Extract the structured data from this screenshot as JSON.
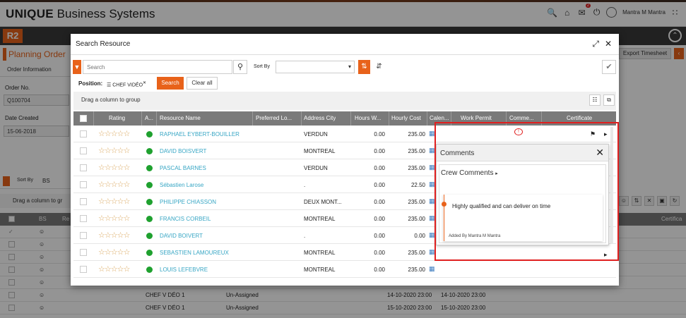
{
  "app": {
    "brand_bold": "UNIQUE",
    "brand_rest": " Business Systems",
    "user_name": "Mantra M Mantra",
    "notifications": "2",
    "module_badge": "R2"
  },
  "page": {
    "tab_title": "Planning Order",
    "sub_tab": "Order Information",
    "order_no_label": "Order No.",
    "order_no_value": "Q100704",
    "date_created_label": "Date Created",
    "date_created_value": "15-06-2018",
    "export_label": "Export Timesheet",
    "sort_by_label": "Sort By",
    "sort_by_value": "BS",
    "drag_text": "Drag a column to gr",
    "bg_headers": [
      "BS",
      "Re",
      "Certifica"
    ],
    "bg_rows": [
      {
        "position": "CHEF V DÉO 1",
        "status": "Un-Assigned",
        "start": "14-10-2020 23:00",
        "end": "14-10-2020 23:00"
      },
      {
        "position": "CHEF V DÉO 1",
        "status": "Un-Assigned",
        "start": "15-10-2020 23:00",
        "end": "15-10-2020 23:00"
      }
    ]
  },
  "modal": {
    "title": "Search Resource",
    "search_placeholder": "Search",
    "sort_by_label": "Sort By",
    "position_label": "Position:",
    "position_value": "CHEF VIDÉO",
    "search_button": "Search",
    "clear_button": "Clear all",
    "group_text": "Drag a column to group",
    "columns": [
      "Rating",
      "A...",
      "Resource Name",
      "Preferred Lo...",
      "Address City",
      "Hours W...",
      "Hourly Cost",
      "Calen...",
      "Work Permit",
      "Comme...",
      "Certificate"
    ],
    "rows": [
      {
        "rating": "☆☆☆☆☆",
        "name": "RAPHAEL EYBERT-BOUILLER",
        "city": "VERDUN",
        "hours": "0.00",
        "cost": "235.00"
      },
      {
        "rating": "☆☆☆☆☆",
        "name": "DAVID BOISVERT",
        "city": "MONTREAL",
        "hours": "0.00",
        "cost": "235.00"
      },
      {
        "rating": "☆☆☆☆☆",
        "name": "PASCAL BARNES",
        "city": "VERDUN",
        "hours": "0.00",
        "cost": "235.00"
      },
      {
        "rating": "☆☆☆☆☆",
        "name": "Sébastien Larose",
        "city": ".",
        "hours": "0.00",
        "cost": "22.50"
      },
      {
        "rating": "☆☆☆☆☆",
        "name": "PHILIPPE CHIASSON",
        "city": "DEUX MONT...",
        "hours": "0.00",
        "cost": "235.00"
      },
      {
        "rating": "☆☆☆☆☆",
        "name": "FRANCIS CORBEIL",
        "city": "MONTREAL",
        "hours": "0.00",
        "cost": "235.00"
      },
      {
        "rating": "☆☆☆☆☆",
        "name": "DAVID BOIVERT",
        "city": ".",
        "hours": "0.00",
        "cost": "0.00"
      },
      {
        "rating": "☆☆☆☆☆",
        "name": "SEBASTIEN LAMOUREUX",
        "city": "MONTREAL",
        "hours": "0.00",
        "cost": "235.00"
      },
      {
        "rating": "☆☆☆☆☆",
        "name": "LOUIS LEFEBVRE",
        "city": "MONTREAL",
        "hours": "0.00",
        "cost": "235.00"
      }
    ]
  },
  "comments": {
    "title": "Comments",
    "crew_title": "Crew Comments",
    "comment_text": "Highly qualified and can deliver on time",
    "added_by": "Added By Mantra M Mantra"
  },
  "colors": {
    "accent": "#e8621a",
    "link": "#37a6c4",
    "available": "#1fa12f",
    "highlight": "#e02020"
  }
}
